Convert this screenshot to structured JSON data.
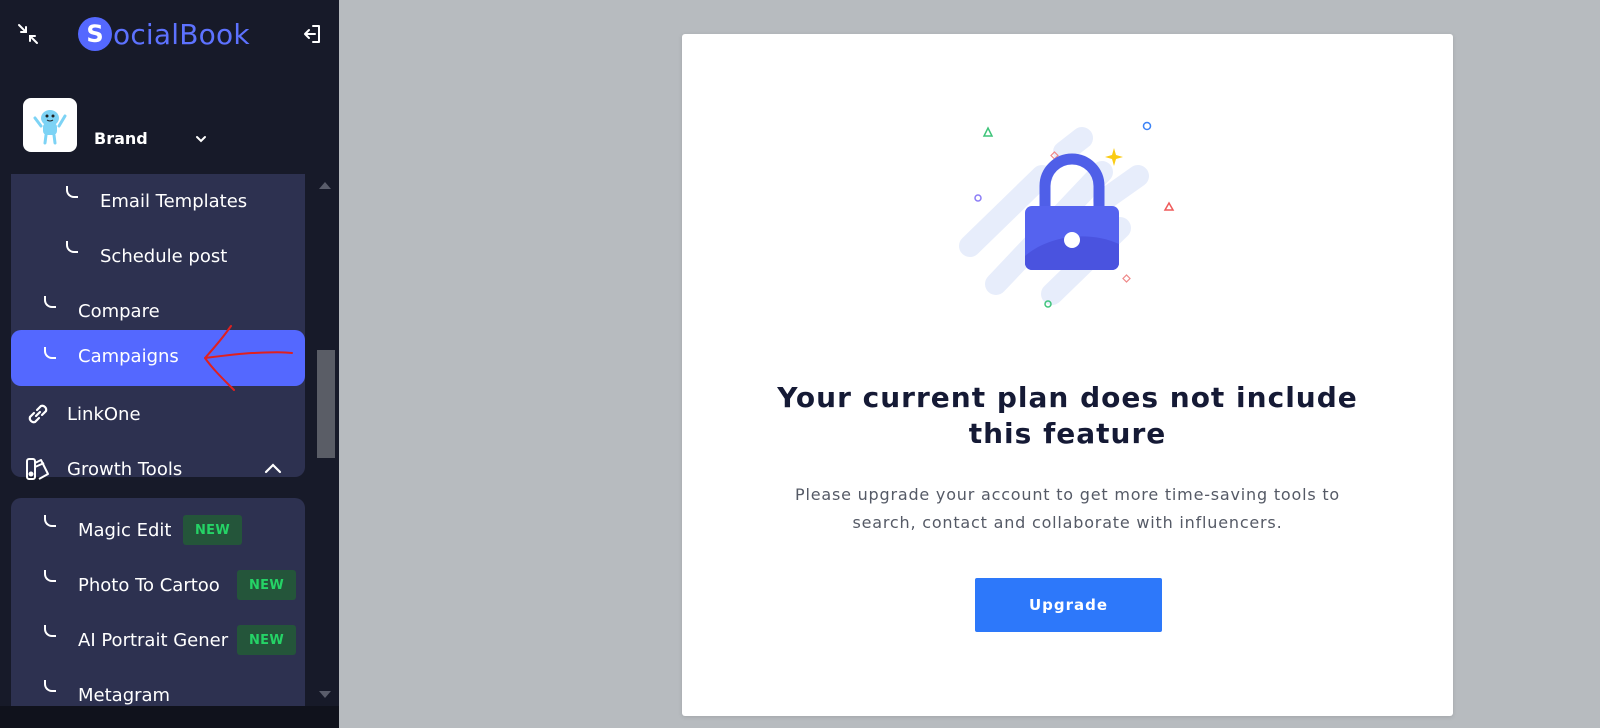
{
  "app": {
    "logo_letter": "S",
    "logo_text": "ocialBook",
    "brand_color": "#5468ff"
  },
  "brand_switcher": {
    "name": "Brand"
  },
  "sidebar": {
    "sub_items": [
      {
        "label": "Email Templates"
      },
      {
        "label": "Schedule post"
      }
    ],
    "items": [
      {
        "label": "Compare"
      },
      {
        "label": "Campaigns",
        "active": true
      },
      {
        "label": "LinkOne",
        "icon": "link-icon"
      },
      {
        "label": "Growth Tools",
        "icon": "growth-tools-icon",
        "expanded": true
      }
    ],
    "growth_tools": [
      {
        "label": "Magic Edit",
        "badge": "NEW"
      },
      {
        "label": "Photo To Cartoo",
        "badge": "NEW"
      },
      {
        "label": "AI Portrait Gener",
        "badge": "NEW"
      },
      {
        "label": "Metagram"
      }
    ]
  },
  "upgrade_card": {
    "title": "Your current plan does not include this feature",
    "description": "Please upgrade your account to get more time-saving tools to search, contact and collaborate with influencers.",
    "button_label": "Upgrade",
    "button_color": "#2d78fa"
  },
  "annotation": {
    "color": "#e0201f",
    "target": "Campaigns"
  }
}
